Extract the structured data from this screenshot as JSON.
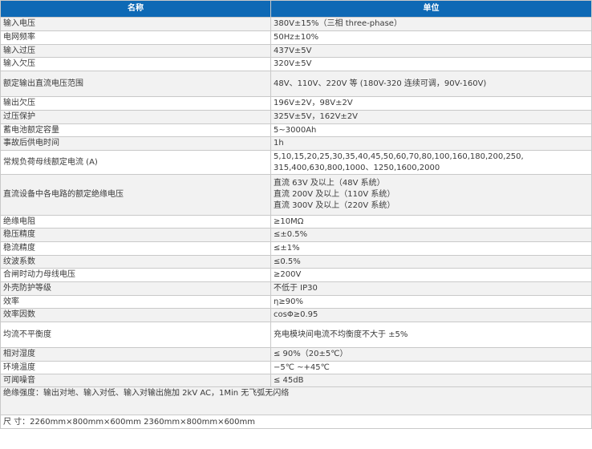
{
  "header": {
    "name_label": "名称",
    "unit_label": "单位"
  },
  "rows": [
    {
      "name": "输入电压",
      "value": [
        "380V±15%（三相 three-phase）"
      ]
    },
    {
      "name": "电网频率",
      "value": [
        "50Hz±10%"
      ]
    },
    {
      "name": "输入过压",
      "value": [
        "437V±5V"
      ]
    },
    {
      "name": "输入欠压",
      "value": [
        "320V±5V"
      ]
    },
    {
      "name": "额定输出直流电压范围",
      "value": [
        "48V、110V、220V 等 (180V-320 连续可调，90V-160V)"
      ]
    },
    {
      "name": "输出欠压",
      "value": [
        "196V±2V，98V±2V"
      ]
    },
    {
      "name": "过压保护",
      "value": [
        "325V±5V，162V±2V"
      ]
    },
    {
      "name": "蓄电池额定容量",
      "value": [
        "5~3000Ah"
      ]
    },
    {
      "name": "事故后供电时间",
      "value": [
        "1h"
      ]
    },
    {
      "name": "常规负荷母线额定电流 (A)",
      "value": [
        "5,10,15,20,25,30,35,40,45,50,60,70,80,100,160,180,200,250,",
        "315,400,630,800,1000、1250,1600,2000"
      ]
    },
    {
      "name": "直流设备中各电路的额定绝缘电压",
      "value": [
        "直流 63V 及以上（48V 系统）",
        "直流 200V 及以上（110V 系统）",
        "直流 300V 及以上（220V 系统）"
      ]
    },
    {
      "name": "绝缘电阻",
      "value": [
        "≥10MΩ"
      ]
    },
    {
      "name": "稳压精度",
      "value": [
        "≤±0.5%"
      ]
    },
    {
      "name": "稳流精度",
      "value": [
        "≤±1%"
      ]
    },
    {
      "name": "纹波系数",
      "value": [
        "≤0.5%"
      ]
    },
    {
      "name": "合闸时动力母线电压",
      "value": [
        "≥200V"
      ]
    },
    {
      "name": "外壳防护等级",
      "value": [
        "不低于 IP30"
      ]
    },
    {
      "name": "效率",
      "value": [
        "η≥90%"
      ]
    },
    {
      "name": "效率因数",
      "value": [
        "cosΦ≥0.95"
      ]
    },
    {
      "name": "均流不平衡度",
      "value": [
        "充电模块间电流不均衡度不大于 ±5%"
      ]
    },
    {
      "name": "相对湿度",
      "value": [
        "≤ 90%（20±5℃）"
      ]
    },
    {
      "name": "环境温度",
      "value": [
        "−5℃ ~+45℃"
      ]
    },
    {
      "name": "可闻噪音",
      "value": [
        "≤ 45dB"
      ]
    }
  ],
  "footnotes": {
    "insulation": "绝缘强度：输出对地、输入对低、输入对输出施加 2kV AC，1Min 无飞弧无闪络",
    "dimensions": "尺 寸：2260mm×800mm×600mm 2360mm×800mm×600mm"
  }
}
